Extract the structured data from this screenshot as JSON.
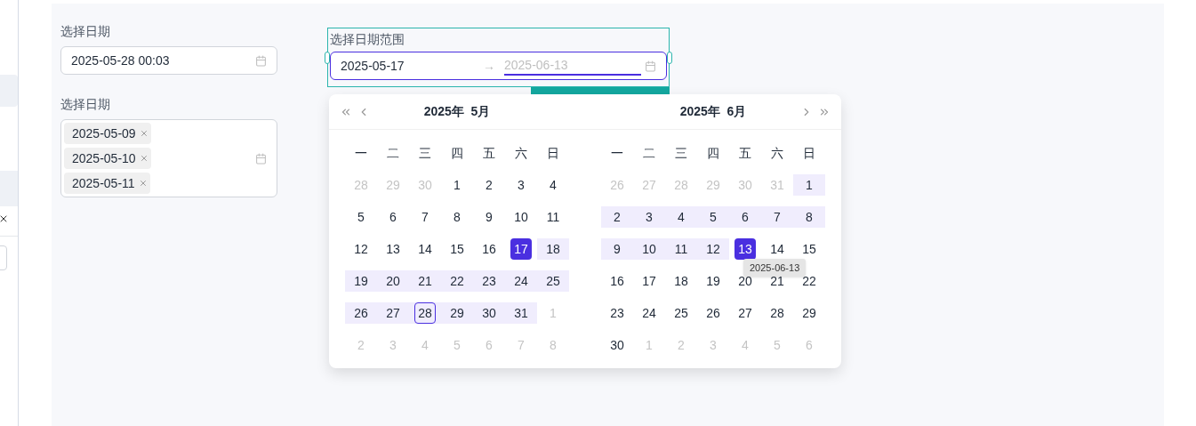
{
  "fields": [
    {
      "kind": "single",
      "label": "选择日期",
      "value": "2025-05-28 00:03"
    },
    {
      "kind": "multiple",
      "label": "选择日期",
      "tags": [
        "2025-05-09",
        "2025-05-10",
        "2025-05-11"
      ]
    }
  ],
  "range_picker": {
    "label": "选择日期范围",
    "start": "2025-05-17",
    "separator": "→",
    "end_placeholder": "2025-06-13",
    "start_focused": false,
    "end_focused": true
  },
  "months": [
    {
      "title": "2025年  5月",
      "weekdays": [
        "一",
        "二",
        "三",
        "四",
        "五",
        "六",
        "日"
      ],
      "weeks": [
        [
          {
            "label": "28",
            "muted": true,
            "in_range": false,
            "selected": false,
            "today": false
          },
          {
            "label": "29",
            "muted": true,
            "in_range": false,
            "selected": false,
            "today": false
          },
          {
            "label": "30",
            "muted": true,
            "in_range": false,
            "selected": false,
            "today": false
          },
          {
            "label": "1",
            "muted": false,
            "in_range": false,
            "selected": false,
            "today": false
          },
          {
            "label": "2",
            "muted": false,
            "in_range": false,
            "selected": false,
            "today": false
          },
          {
            "label": "3",
            "muted": false,
            "in_range": false,
            "selected": false,
            "today": false
          },
          {
            "label": "4",
            "muted": false,
            "in_range": false,
            "selected": false,
            "today": false
          }
        ],
        [
          {
            "label": "5",
            "muted": false,
            "in_range": false,
            "selected": false,
            "today": false
          },
          {
            "label": "6",
            "muted": false,
            "in_range": false,
            "selected": false,
            "today": false
          },
          {
            "label": "7",
            "muted": false,
            "in_range": false,
            "selected": false,
            "today": false
          },
          {
            "label": "8",
            "muted": false,
            "in_range": false,
            "selected": false,
            "today": false
          },
          {
            "label": "9",
            "muted": false,
            "in_range": false,
            "selected": false,
            "today": false
          },
          {
            "label": "10",
            "muted": false,
            "in_range": false,
            "selected": false,
            "today": false
          },
          {
            "label": "11",
            "muted": false,
            "in_range": false,
            "selected": false,
            "today": false
          }
        ],
        [
          {
            "label": "12",
            "muted": false,
            "in_range": false,
            "selected": false,
            "today": false
          },
          {
            "label": "13",
            "muted": false,
            "in_range": false,
            "selected": false,
            "today": false
          },
          {
            "label": "14",
            "muted": false,
            "in_range": false,
            "selected": false,
            "today": false
          },
          {
            "label": "15",
            "muted": false,
            "in_range": false,
            "selected": false,
            "today": false
          },
          {
            "label": "16",
            "muted": false,
            "in_range": false,
            "selected": false,
            "today": false
          },
          {
            "label": "17",
            "muted": false,
            "in_range": false,
            "selected": true,
            "today": false
          },
          {
            "label": "18",
            "muted": false,
            "in_range": true,
            "selected": false,
            "today": false
          }
        ],
        [
          {
            "label": "19",
            "muted": false,
            "in_range": true,
            "selected": false,
            "today": false
          },
          {
            "label": "20",
            "muted": false,
            "in_range": true,
            "selected": false,
            "today": false
          },
          {
            "label": "21",
            "muted": false,
            "in_range": true,
            "selected": false,
            "today": false
          },
          {
            "label": "22",
            "muted": false,
            "in_range": true,
            "selected": false,
            "today": false
          },
          {
            "label": "23",
            "muted": false,
            "in_range": true,
            "selected": false,
            "today": false
          },
          {
            "label": "24",
            "muted": false,
            "in_range": true,
            "selected": false,
            "today": false
          },
          {
            "label": "25",
            "muted": false,
            "in_range": true,
            "selected": false,
            "today": false
          }
        ],
        [
          {
            "label": "26",
            "muted": false,
            "in_range": true,
            "selected": false,
            "today": false
          },
          {
            "label": "27",
            "muted": false,
            "in_range": true,
            "selected": false,
            "today": false
          },
          {
            "label": "28",
            "muted": false,
            "in_range": true,
            "selected": false,
            "today": true
          },
          {
            "label": "29",
            "muted": false,
            "in_range": true,
            "selected": false,
            "today": false
          },
          {
            "label": "30",
            "muted": false,
            "in_range": true,
            "selected": false,
            "today": false
          },
          {
            "label": "31",
            "muted": false,
            "in_range": true,
            "selected": false,
            "today": false
          },
          {
            "label": "1",
            "muted": true,
            "in_range": false,
            "selected": false,
            "today": false
          }
        ],
        [
          {
            "label": "2",
            "muted": true,
            "in_range": false,
            "selected": false,
            "today": false
          },
          {
            "label": "3",
            "muted": true,
            "in_range": false,
            "selected": false,
            "today": false
          },
          {
            "label": "4",
            "muted": true,
            "in_range": false,
            "selected": false,
            "today": false
          },
          {
            "label": "5",
            "muted": true,
            "in_range": false,
            "selected": false,
            "today": false
          },
          {
            "label": "6",
            "muted": true,
            "in_range": false,
            "selected": false,
            "today": false
          },
          {
            "label": "7",
            "muted": true,
            "in_range": false,
            "selected": false,
            "today": false
          },
          {
            "label": "8",
            "muted": true,
            "in_range": false,
            "selected": false,
            "today": false
          }
        ]
      ]
    },
    {
      "title": "2025年  6月",
      "weekdays": [
        "一",
        "二",
        "三",
        "四",
        "五",
        "六",
        "日"
      ],
      "weeks": [
        [
          {
            "label": "26",
            "muted": true,
            "in_range": false,
            "selected": false,
            "today": false
          },
          {
            "label": "27",
            "muted": true,
            "in_range": false,
            "selected": false,
            "today": false
          },
          {
            "label": "28",
            "muted": true,
            "in_range": false,
            "selected": false,
            "today": false
          },
          {
            "label": "29",
            "muted": true,
            "in_range": false,
            "selected": false,
            "today": false
          },
          {
            "label": "30",
            "muted": true,
            "in_range": false,
            "selected": false,
            "today": false
          },
          {
            "label": "31",
            "muted": true,
            "in_range": false,
            "selected": false,
            "today": false
          },
          {
            "label": "1",
            "muted": false,
            "in_range": true,
            "selected": false,
            "today": false
          }
        ],
        [
          {
            "label": "2",
            "muted": false,
            "in_range": true,
            "selected": false,
            "today": false
          },
          {
            "label": "3",
            "muted": false,
            "in_range": true,
            "selected": false,
            "today": false
          },
          {
            "label": "4",
            "muted": false,
            "in_range": true,
            "selected": false,
            "today": false
          },
          {
            "label": "5",
            "muted": false,
            "in_range": true,
            "selected": false,
            "today": false
          },
          {
            "label": "6",
            "muted": false,
            "in_range": true,
            "selected": false,
            "today": false
          },
          {
            "label": "7",
            "muted": false,
            "in_range": true,
            "selected": false,
            "today": false
          },
          {
            "label": "8",
            "muted": false,
            "in_range": true,
            "selected": false,
            "today": false
          }
        ],
        [
          {
            "label": "9",
            "muted": false,
            "in_range": true,
            "selected": false,
            "today": false
          },
          {
            "label": "10",
            "muted": false,
            "in_range": true,
            "selected": false,
            "today": false
          },
          {
            "label": "11",
            "muted": false,
            "in_range": true,
            "selected": false,
            "today": false
          },
          {
            "label": "12",
            "muted": false,
            "in_range": true,
            "selected": false,
            "today": false
          },
          {
            "label": "13",
            "muted": false,
            "in_range": false,
            "selected": true,
            "today": false,
            "tooltip": "2025-06-13"
          },
          {
            "label": "14",
            "muted": false,
            "in_range": false,
            "selected": false,
            "today": false
          },
          {
            "label": "15",
            "muted": false,
            "in_range": false,
            "selected": false,
            "today": false
          }
        ],
        [
          {
            "label": "16",
            "muted": false,
            "in_range": false,
            "selected": false,
            "today": false
          },
          {
            "label": "17",
            "muted": false,
            "in_range": false,
            "selected": false,
            "today": false
          },
          {
            "label": "18",
            "muted": false,
            "in_range": false,
            "selected": false,
            "today": false
          },
          {
            "label": "19",
            "muted": false,
            "in_range": false,
            "selected": false,
            "today": false
          },
          {
            "label": "20",
            "muted": false,
            "in_range": false,
            "selected": false,
            "today": false
          },
          {
            "label": "21",
            "muted": false,
            "in_range": false,
            "selected": false,
            "today": false
          },
          {
            "label": "22",
            "muted": false,
            "in_range": false,
            "selected": false,
            "today": false
          }
        ],
        [
          {
            "label": "23",
            "muted": false,
            "in_range": false,
            "selected": false,
            "today": false
          },
          {
            "label": "24",
            "muted": false,
            "in_range": false,
            "selected": false,
            "today": false
          },
          {
            "label": "25",
            "muted": false,
            "in_range": false,
            "selected": false,
            "today": false
          },
          {
            "label": "26",
            "muted": false,
            "in_range": false,
            "selected": false,
            "today": false
          },
          {
            "label": "27",
            "muted": false,
            "in_range": false,
            "selected": false,
            "today": false
          },
          {
            "label": "28",
            "muted": false,
            "in_range": false,
            "selected": false,
            "today": false
          },
          {
            "label": "29",
            "muted": false,
            "in_range": false,
            "selected": false,
            "today": false
          }
        ],
        [
          {
            "label": "30",
            "muted": false,
            "in_range": false,
            "selected": false,
            "today": false
          },
          {
            "label": "1",
            "muted": true,
            "in_range": false,
            "selected": false,
            "today": false
          },
          {
            "label": "2",
            "muted": true,
            "in_range": false,
            "selected": false,
            "today": false
          },
          {
            "label": "3",
            "muted": true,
            "in_range": false,
            "selected": false,
            "today": false
          },
          {
            "label": "4",
            "muted": true,
            "in_range": false,
            "selected": false,
            "today": false
          },
          {
            "label": "5",
            "muted": true,
            "in_range": false,
            "selected": false,
            "today": false
          },
          {
            "label": "6",
            "muted": true,
            "in_range": false,
            "selected": false,
            "today": false
          }
        ]
      ]
    }
  ]
}
